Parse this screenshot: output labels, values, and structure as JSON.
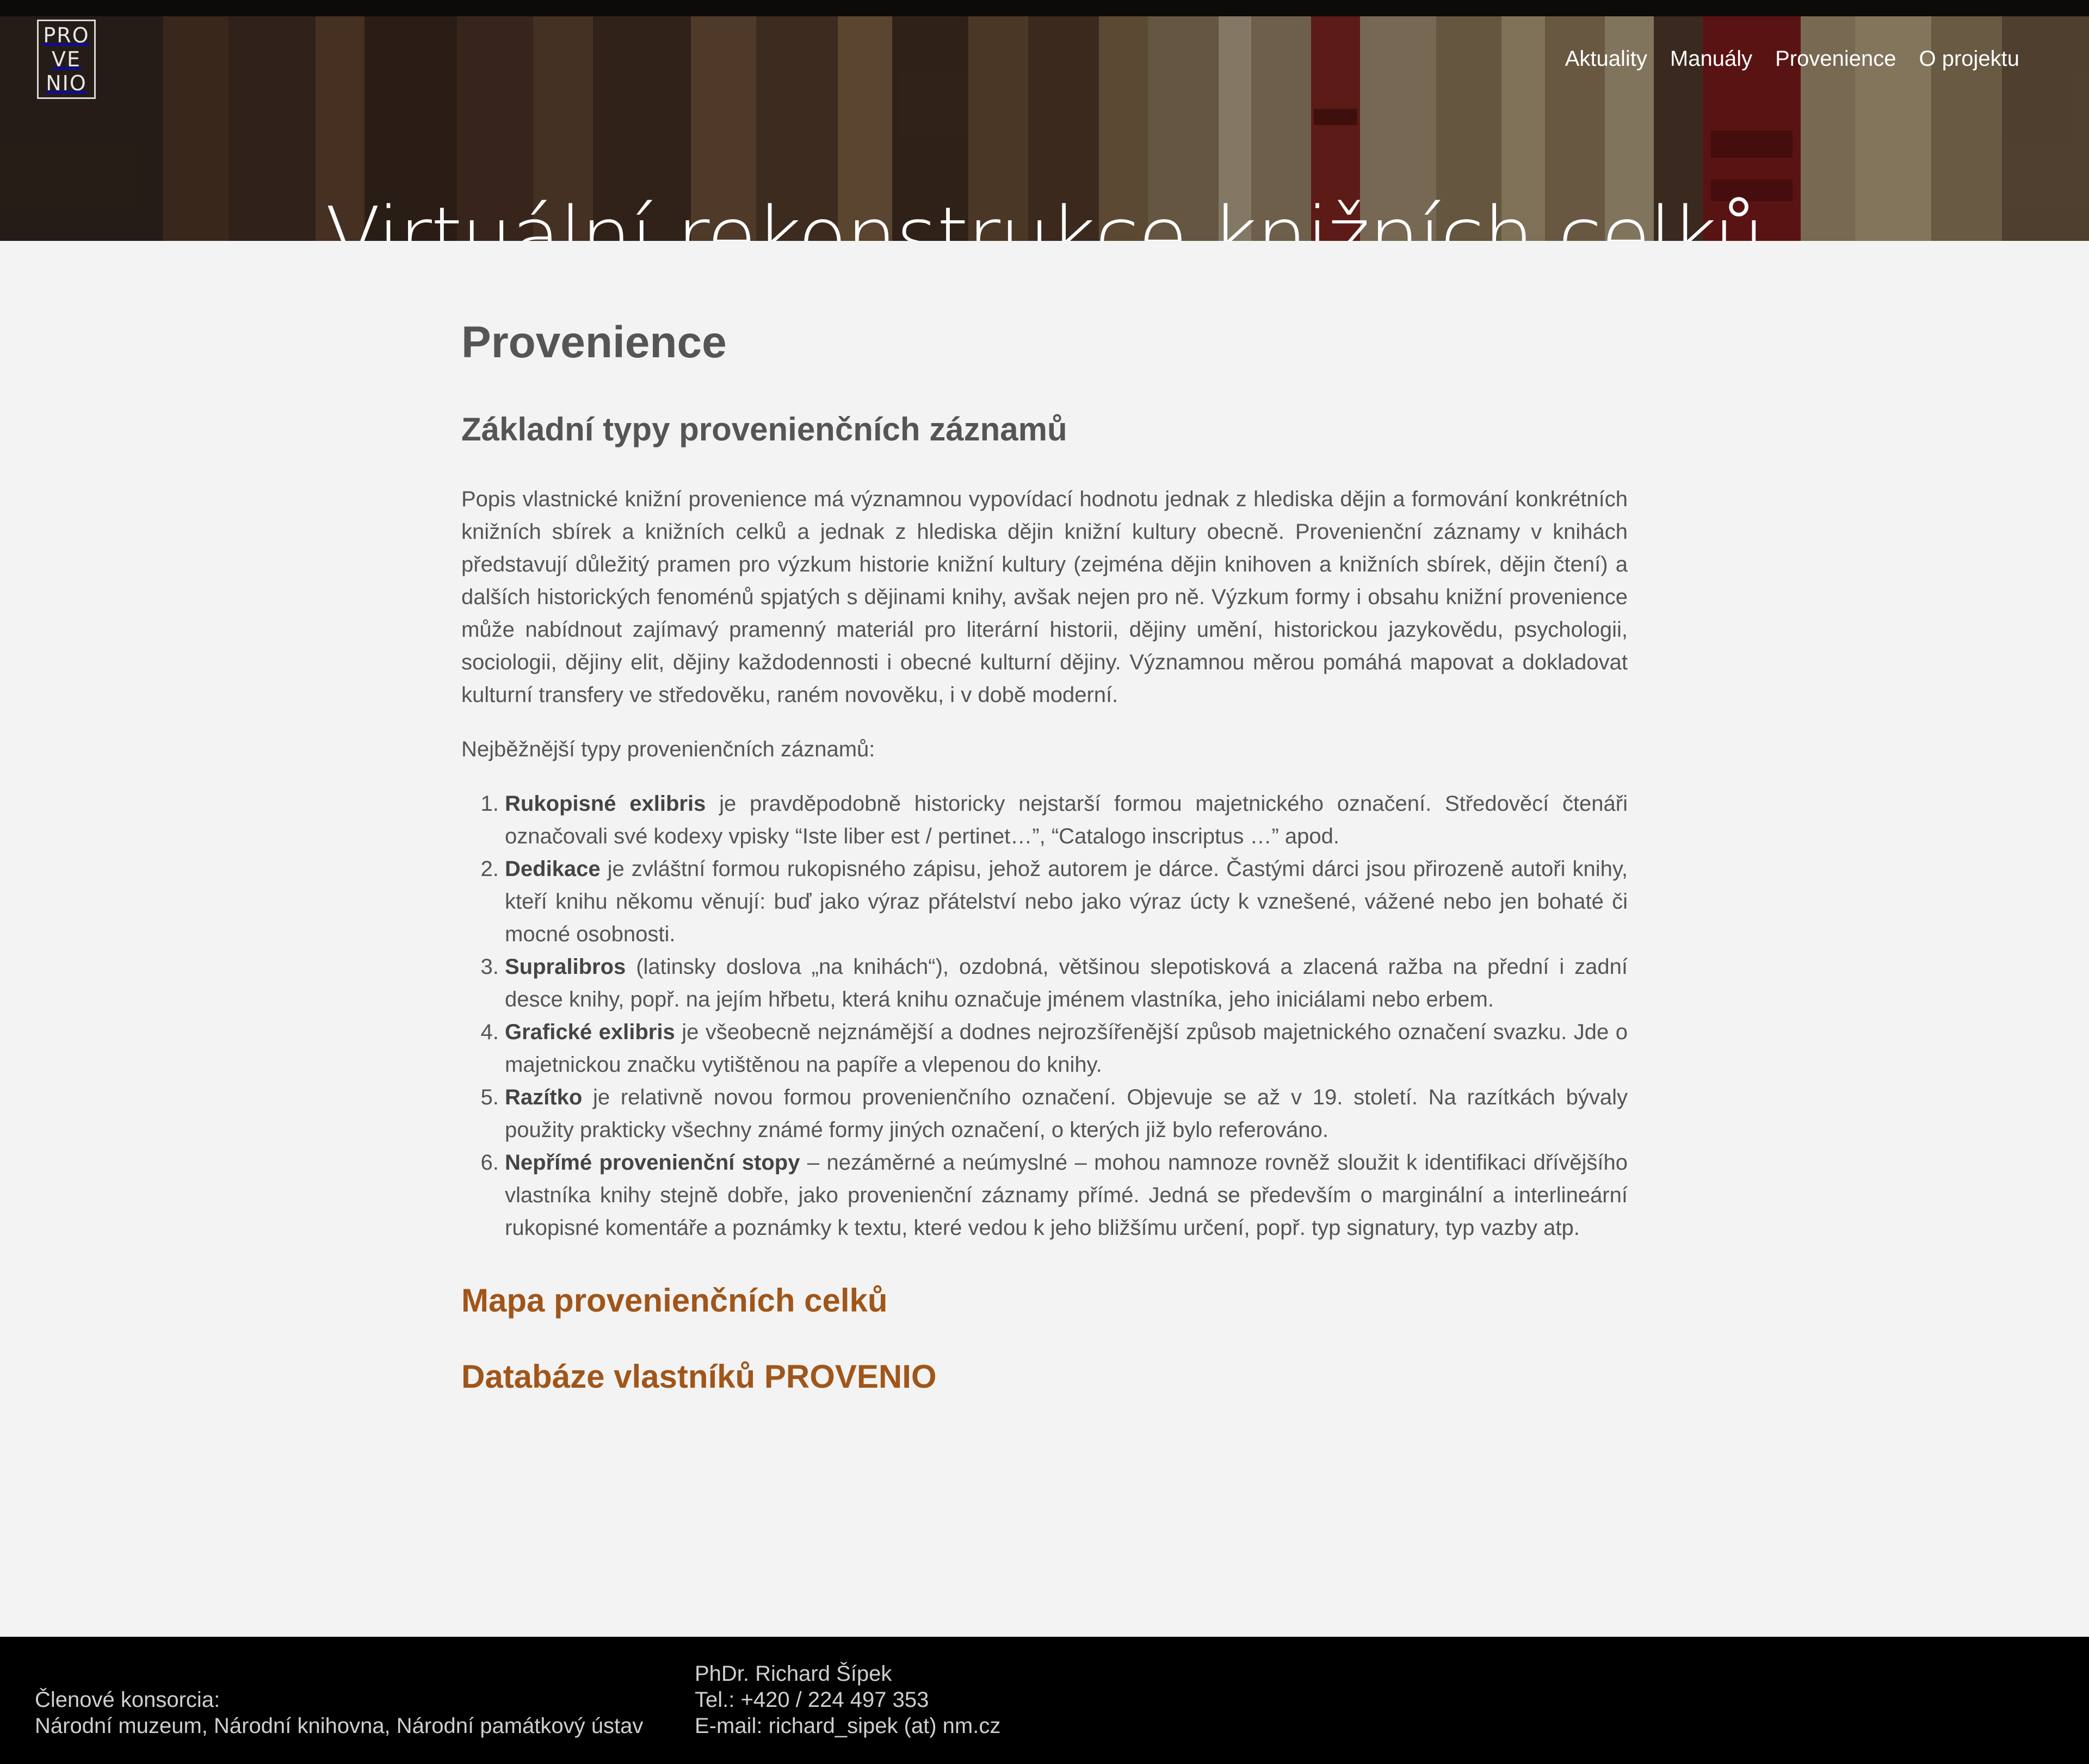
{
  "logo": {
    "lines": [
      "PRO",
      "VE",
      "NIO"
    ]
  },
  "nav": {
    "items": [
      {
        "label": "Aktuality"
      },
      {
        "label": "Manuály"
      },
      {
        "label": "Provenience"
      },
      {
        "label": "O projektu"
      }
    ]
  },
  "hero": {
    "title": "Virtuální rekonstrukce knižních celků"
  },
  "main": {
    "page_title": "Provenience",
    "section_title": "Základní typy provenienčních záznamů",
    "intro_paragraph": "Popis vlastnické knižní provenience má významnou vypovídací hodnotu jednak z hlediska dějin a formování konkrétních knižních sbírek a knižních celků a jednak z hlediska dějin knižní kultury obecně. Provenienční záznamy v knihách představují důležitý pramen pro výzkum historie knižní kultury (zejména dějin knihoven a knižních sbírek, dějin čtení) a dalších historických fenoménů spjatých s dějinami knihy, avšak nejen pro ně. Výzkum formy i obsahu knižní provenience může nabídnout zajímavý pramenný materiál pro literární historii, dějiny umění, historickou jazykovědu, psychologii, sociologii, dějiny elit, dějiny každodennosti i obecné kulturní dějiny. Významnou měrou pomáhá mapovat a dokladovat kulturní transfery ve středověku, raném novověku, i v době moderní.",
    "list_intro": "Nejběžnější typy provenienčních záznamů:",
    "list": [
      {
        "term": "Rukopisné exlibris",
        "text": " je pravděpodobně historicky nejstarší formou majetnického označení. Středověcí čtenáři označovali své kodexy vpisky “Iste liber est / pertinet…”, “Catalogo inscriptus …” apod."
      },
      {
        "term": "Dedikace",
        "text": " je zvláštní formou rukopisného zápisu, jehož autorem je dárce. Častými dárci jsou přirozeně autoři knihy, kteří knihu někomu věnují: buď jako výraz přátelství nebo jako výraz úcty k vznešené, vážené nebo jen bohaté či mocné osobnosti."
      },
      {
        "term": "Supralibros",
        "text": " (latinsky doslova „na knihách“), ozdobná, většinou slepotisková a zlacená ražba na přední i zadní desce knihy, popř. na jejím hřbetu, která knihu označuje jménem vlastníka, jeho iniciálami nebo erbem."
      },
      {
        "term": "Grafické exlibris",
        "text": " je všeobecně nejznámější a dodnes nejrozšířenější způsob majetnického označení svazku. Jde o majetnickou značku vytištěnou na papíře a vlepenou do knihy."
      },
      {
        "term": "Razítko",
        "text": " je relativně novou formou provenienčního označení. Objevuje se až v 19. století. Na razítkách bývaly použity prakticky všechny známé formy jiných označení, o kterých již bylo referováno."
      },
      {
        "term": "Nepřímé provenienční stopy",
        "text": " – nezáměrné a neúmyslné – mohou namnoze rovněž sloužit k identifikaci dřívějšího vlastníka knihy stejně dobře, jako provenienční záznamy přímé. Jedná se především o marginální a interlineární rukopisné komentáře a poznámky k textu, které vedou k jeho bližšímu určení, popř. typ signatury, typ vazby atp."
      }
    ],
    "link_map": "Mapa provenienčních celků",
    "link_database": "Databáze vlastníků PROVENIO",
    "link_color": "#a0561a"
  },
  "footer": {
    "consortium_label": "Členové konsorcia:",
    "consortium_members": "Národní muzeum, Národní knihovna, Národní památkový ústav",
    "contact_name": "PhDr. Richard Šípek",
    "contact_phone": "Tel.: +420 / 224 497 353",
    "contact_email": "E-mail: richard_sipek (at) nm.cz"
  }
}
